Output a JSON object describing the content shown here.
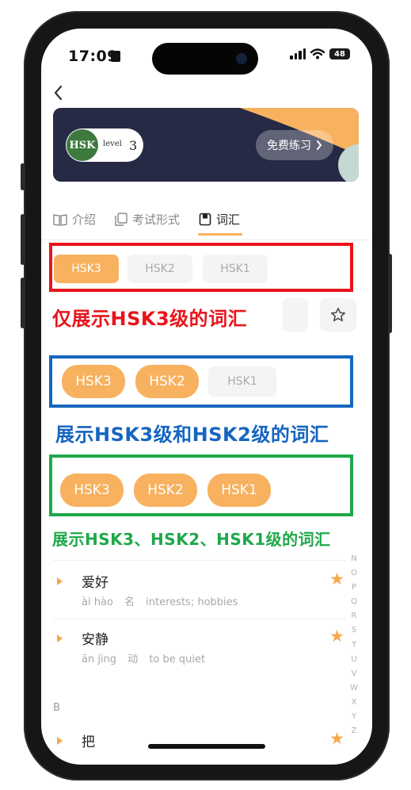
{
  "status": {
    "time": "17:09",
    "battery": "48"
  },
  "banner": {
    "logo_text": "HSK",
    "logo_level": "level",
    "logo_num": "3",
    "practice_label": "免费练习"
  },
  "tabs": [
    {
      "label": "介绍",
      "icon": "book-icon"
    },
    {
      "label": "考试形式",
      "icon": "copy-icon"
    },
    {
      "label": "词汇",
      "icon": "vocab-icon",
      "active": true
    }
  ],
  "filters": {
    "demo1": [
      "HSK3",
      "HSK2",
      "HSK1"
    ],
    "demo2": [
      "HSK3",
      "HSK2",
      "HSK1"
    ],
    "demo3": [
      "HSK3",
      "HSK2",
      "HSK1"
    ]
  },
  "captions": {
    "c1": "仅展示HSK3级的词汇",
    "c2": "展示HSK3级和HSK2级的词汇",
    "c3": "展示HSK3、HSK2、HSK1级的词汇"
  },
  "colors": {
    "accent": "#f7b15f",
    "red": "#e8141b",
    "blue": "#1565c0",
    "green": "#1fa84a"
  },
  "words": [
    {
      "hanzi": "爱好",
      "pinyin": "ài hào",
      "pos": "名",
      "meaning": "interests; hobbies"
    },
    {
      "hanzi": "安静",
      "pinyin": "ān jìng",
      "pos": "动",
      "meaning": "to be quiet"
    },
    {
      "hanzi": "把"
    }
  ],
  "section_b": "B",
  "alphabet": [
    "N",
    "O",
    "P",
    "Q",
    "R",
    "S",
    "T",
    "U",
    "V",
    "W",
    "X",
    "Y",
    "Z"
  ]
}
